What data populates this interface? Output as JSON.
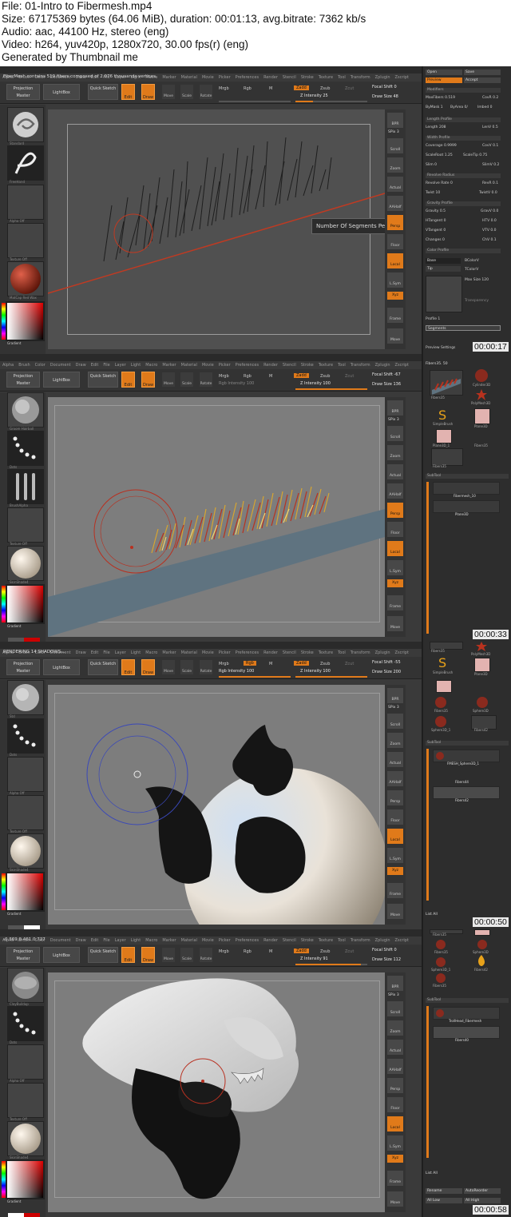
{
  "header": {
    "file": "File: 01-Intro to Fibermesh.mp4",
    "size": "Size: 67175369 bytes (64.06 MiB), duration: 00:01:13, avg.bitrate: 7362 kb/s",
    "audio": "Audio: aac, 44100 Hz, stereo (eng)",
    "video": "Video: h264, yuv420p, 1280x720, 30.00 fps(r) (eng)",
    "generated": "Generated by Thumbnail me"
  },
  "menu": [
    "Alpha",
    "Brush",
    "Color",
    "Document",
    "Draw",
    "Edit",
    "File",
    "Layer",
    "Light",
    "Macro",
    "Marker",
    "Material",
    "Movie",
    "Picker",
    "Preferences",
    "Render",
    "Stencil",
    "Stroke",
    "Texture",
    "Tool",
    "Transform",
    "Zplugin",
    "Zscript"
  ],
  "toolbar": {
    "projection_master": "Projection Master",
    "lightbox": "LightBox",
    "quick_sketch": "Quick Sketch",
    "edit": "Edit",
    "draw": "Draw",
    "move": "Move",
    "scale": "Scale",
    "rotate": "Rotate",
    "mrgb": "Mrgb",
    "rgb": "Rgb",
    "m": "M",
    "zadd": "Zadd",
    "zsub": "Zsub",
    "zcut": "Zcut",
    "rgb_intensity": "Rgb Intensity",
    "z_intensity": "Z Intensity",
    "focal_shift": "Focal Shift",
    "draw_size": "Draw Size"
  },
  "shelf_right": [
    "BPR",
    "SPix",
    "Scroll",
    "Zoom",
    "Actual",
    "AAHalf",
    "Persp",
    "Floor",
    "Local",
    "L.Sym",
    "Xyz",
    "Frame",
    "Move"
  ],
  "frames": [
    {
      "timestamp": "00:00:17",
      "status": "FiberMesh contains 519 fibers composed of 2.076 thousands vertices.",
      "status_number_1": "519",
      "status_number_2": "2.076",
      "z_intensity": "Z Intensity 25",
      "rgb_intensity": "",
      "focal_shift": "Focal Shift 0",
      "draw_size": "Draw Size 48",
      "spix": "SPix 3",
      "tooltip": "Number Of Segments Per Fiber",
      "left": [
        "Standard",
        "FreeHand",
        "Alpha Off",
        "Texture Off",
        "MatCap Red Wax"
      ],
      "gradient": "Gradient"
    },
    {
      "timestamp": "00:00:33",
      "status": "",
      "z_intensity": "Z Intensity 100",
      "rgb_intensity": "Rgb Intensity 100",
      "focal_shift": "Focal Shift -67",
      "draw_size": "Draw Size 136",
      "spix": "SPix 3",
      "left": [
        "Groom Hairball",
        "Dots",
        "BrushAlpha",
        "Texture Off",
        "SkinShade4"
      ],
      "gradient": "Gradient",
      "subtool": "SubTool",
      "tools": [
        [
          "Fibers35",
          "Cylinder3D",
          "PolyMesh3D",
          "SimpleBrush",
          "Plane3D",
          "Fibers35"
        ],
        [
          "Plane3D_1",
          "Fibers35"
        ]
      ],
      "tool_header": "Fibers35. 50",
      "subtool_items": [
        "Fibermesh_10",
        "Plane3D"
      ]
    },
    {
      "timestamp": "00:00:50",
      "status": "RENDERING 14 SHADOWS...",
      "z_intensity": "Z Intensity 100",
      "rgb_intensity": "Rgb Intensity 100",
      "focal_shift": "Focal Shift -55",
      "draw_size": "Draw Size 200",
      "spix": "SPix 3",
      "left": [
        "Std",
        "Dots",
        "Alpha Off",
        "Texture Off",
        "SkinShade4"
      ],
      "gradient": "Gradient",
      "subtool": "SubTool",
      "tools_top": [
        "Fibers35",
        "PolyMesh3D",
        "SimpleBrush",
        "Plane3D",
        "Fibers35",
        "Sphere3D",
        "Sphere3D_1",
        "Fibers42"
      ],
      "subtool_items": [
        "FMESH_Sphere3D_1",
        "Fibers44",
        "Fibers42"
      ],
      "list_all": "List All"
    },
    {
      "timestamp": "00:00:58",
      "status": "-0.369,0.461,0.727",
      "z_intensity": "Z Intensity 91",
      "rgb_intensity": "",
      "focal_shift": "Focal Shift 0",
      "draw_size": "Draw Size 112",
      "spix": "SPix 3",
      "left": [
        "ClayBuildup",
        "Dots",
        "Alpha Off",
        "Texture Off",
        "SkinShade4"
      ],
      "gradient": "Gradient",
      "subtool": "SubTool",
      "tools_top": [
        "Fibers35",
        "Fibers35",
        "Sphere3D",
        "Sphere3D_1",
        "Fibers42",
        "Fibers35"
      ],
      "subtool_items": [
        "TrollHead_Fibermesh",
        "Fibers40"
      ],
      "list_all": "List All",
      "rename": "Rename",
      "auto_reorder": "AutoReorder",
      "all_low": "All Low",
      "all_high": "All High"
    }
  ],
  "fiber_panel": {
    "open": "Open",
    "save": "Save",
    "preview": "Preview",
    "accept": "Accept",
    "modifiers": "Modifiers",
    "max_fibers": "MaxFibers 0.519",
    "cov_r": "CovR 0.2",
    "by_mask": "ByMask 1",
    "by_area": "ByArea 0/",
    "imbed": "Imbed 0",
    "length_profile": "Length Profile",
    "length": "Length 208",
    "len_v": "LenV 0.5",
    "width_profile": "Width Profile",
    "coverage": "Coverage 0.9999",
    "cov_v": "CovV 0.1",
    "scale_root": "ScaleRoot 1.25",
    "scale_tip": "ScaleTip 0.75",
    "slim": "Slim 0",
    "slim_v": "SlimV 0.2",
    "revolve_radius": "Revolve Radius",
    "revolve_rate": "Revolve Rate 0",
    "rev_r": "RevR 0.1",
    "twist": "Twist 10",
    "twist_v": "TwistV 0.0",
    "gravity_profile": "Gravity Profile",
    "gravity": "Gravity 0.5",
    "grav_v": "GravV 0.0",
    "h_tangent": "HTangent 0",
    "htv": "HTV 0.0",
    "v_tangent": "VTangent 0",
    "vtv": "VTV 0.0",
    "changes": "Changes 0",
    "chv": "ChV 0.1",
    "color_profile": "Color Profile",
    "base": "Base",
    "tip": "Tip",
    "bcolor": "BColorV",
    "bcvar": "BCVar",
    "tcolor": "TColorV",
    "tcvar": "TCVar",
    "fibers": "Fibers",
    "max_size": "Max Size 120",
    "transparency": "Transparency",
    "profile": "Profile 1",
    "segments": "Segments",
    "preview_settings": "Preview Settings",
    "lightbox_tools": "Lightbox tools"
  },
  "colors": {
    "accent": "#e07a1a",
    "panel": "#2d2d2d",
    "canvas_dark": "#505050",
    "canvas_grey": "#7d7d7d"
  }
}
